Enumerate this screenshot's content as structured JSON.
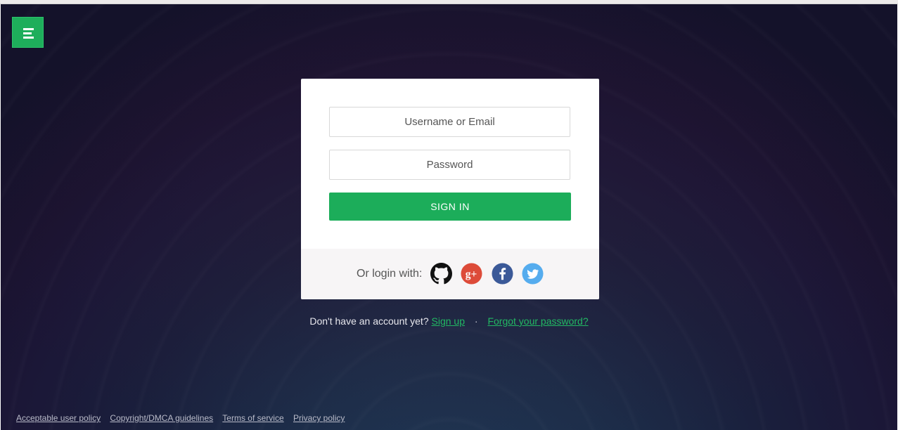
{
  "login": {
    "username_placeholder": "Username or Email",
    "password_placeholder": "Password",
    "signin_label": "SIGN IN",
    "social_label": "Or login with:",
    "social_icons": [
      "github-icon",
      "google-plus-icon",
      "facebook-icon",
      "twitter-icon"
    ]
  },
  "below": {
    "no_account_text": "Don't have an account yet?",
    "signup_link": "Sign up",
    "separator": "·",
    "forgot_link": "Forgot your password?"
  },
  "footer": {
    "links": [
      "Acceptable user policy",
      "Copyright/DMCA guidelines",
      "Terms of service",
      "Privacy policy"
    ]
  },
  "colors": {
    "accent_green": "#1cad5a",
    "link_green": "#22b863",
    "google_red": "#dd4b39",
    "facebook_blue": "#3b5998",
    "twitter_blue": "#55acee"
  }
}
